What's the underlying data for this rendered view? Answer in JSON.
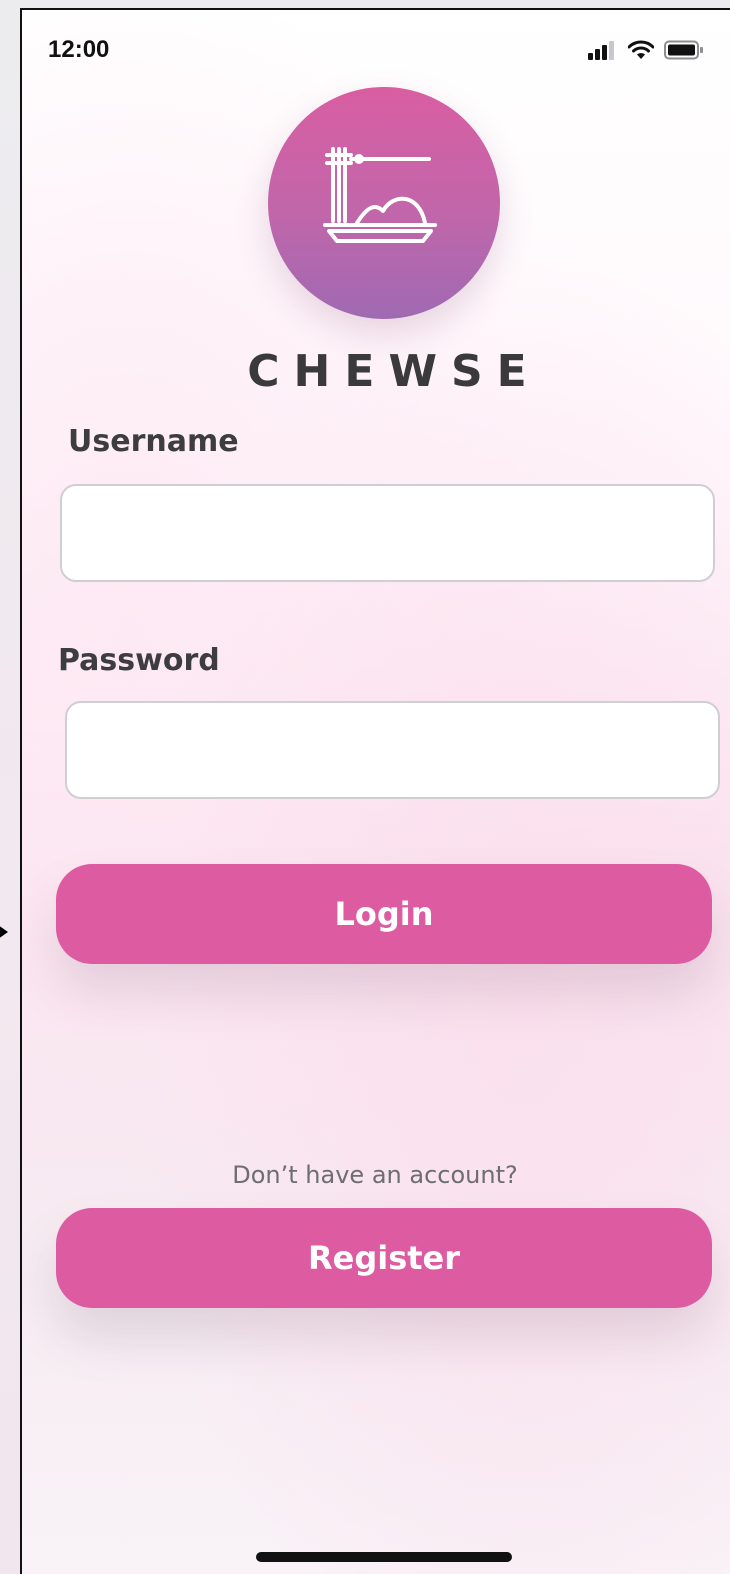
{
  "status_bar": {
    "time": "12:00",
    "icons": [
      "signal-icon",
      "wifi-icon",
      "battery-icon"
    ]
  },
  "brand": {
    "logo_icon": "noodle-bowl-fork-icon",
    "name": "CHEWSE"
  },
  "form": {
    "username_label": "Username",
    "username_value": "",
    "password_label": "Password",
    "password_value": "",
    "login_label": "Login"
  },
  "register": {
    "prompt": "Don’t have an account?",
    "button_label": "Register"
  },
  "colors": {
    "accent": "#dc5ba1",
    "logo_top": "#d95ea2",
    "logo_bottom": "#9f6ab2",
    "text_dark": "#3a3a3d"
  }
}
